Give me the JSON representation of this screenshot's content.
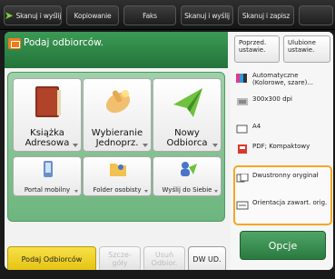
{
  "topbar": {
    "tabs": [
      {
        "label": "Skanuj i wyślij"
      },
      {
        "label": "Kopiowanie"
      },
      {
        "label": "Faks"
      },
      {
        "label": "Skanuj i wyślij"
      },
      {
        "label": "Skanuj i zapisz"
      }
    ]
  },
  "window": {
    "title": "Podaj odbiorców."
  },
  "destinations": {
    "big_buttons": [
      {
        "label": "Książka Adresowa",
        "icon": "address-book-icon"
      },
      {
        "label": "Wybieranie Jednoprz.",
        "icon": "one-touch-icon"
      },
      {
        "label": "Nowy Odbiorca",
        "icon": "paper-plane-icon"
      }
    ],
    "small_buttons": [
      {
        "label": "Portal mobilny",
        "icon": "mobile-portal-icon"
      },
      {
        "label": "Folder osobisty",
        "icon": "folder-icon"
      },
      {
        "label": "Wyślij do Siebie",
        "icon": "send-to-self-icon"
      }
    ]
  },
  "bottom_tabs": [
    {
      "label": "Podaj Odbiorców",
      "state": "active"
    },
    {
      "label": "Szcze- góły",
      "state": "disabled"
    },
    {
      "label": "Usuń Odbior.",
      "state": "disabled"
    },
    {
      "label": "DW UD.",
      "state": "normal"
    }
  ],
  "settings": {
    "top_buttons": [
      {
        "label": "Poprzed. ustawie."
      },
      {
        "label": "Ulubione ustawie."
      }
    ],
    "color_mode": "Automatyczne (Kolorowe, szare)...",
    "resolution": "300x300 dpi",
    "paper_size": "A4",
    "file_format": "PDF; Kompaktowy",
    "duplex": "Dwustronny oryginał",
    "orientation": "Orientacja zawart. orig.",
    "options_label": "Opcje"
  },
  "colors": {
    "accent_green": "#2f8a47",
    "highlight_orange": "#f5a623",
    "active_tab_yellow": "#f2d21a"
  }
}
